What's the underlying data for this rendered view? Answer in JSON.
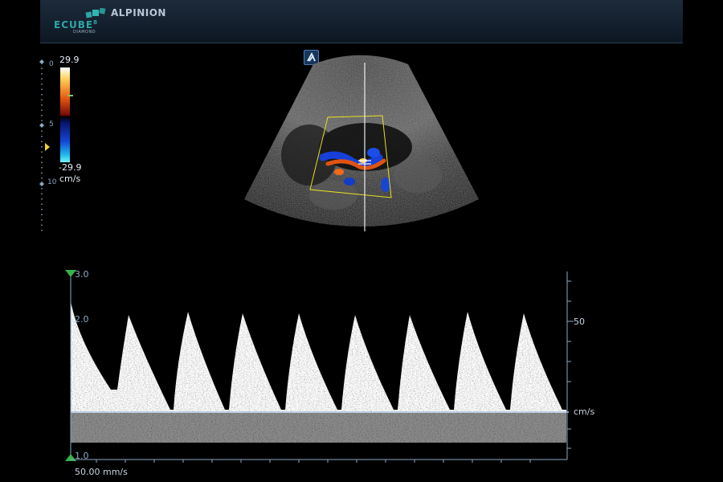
{
  "header": {
    "logo_word": "ECUBE",
    "logo_number": "8",
    "logo_sub": "DIAMOND",
    "brand": "ALPINION"
  },
  "icons": {
    "probe": "alpinion-a-icon",
    "focus_marker": "focus-triangle-icon",
    "baseline_marker_top": "triangle-down-icon",
    "baseline_marker_bottom": "triangle-up-icon"
  },
  "colors": {
    "header_bg": "#0d1723",
    "accent": "#2fa6a6",
    "scale_line": "#8ea7c4",
    "focus_marker": "#f0d22a",
    "roi_box": "#e8e020"
  },
  "depth_scale": {
    "labels": [
      "0",
      "5",
      "10"
    ]
  },
  "color_scale": {
    "max": "29.9",
    "min": "-29.9",
    "unit": "cm/s"
  },
  "doppler": {
    "left_ticks": [
      "3.0",
      "2.0",
      "1.0"
    ],
    "right_label": "50",
    "unit": "cm/s",
    "sweep_speed": "50.00 mm/s"
  }
}
